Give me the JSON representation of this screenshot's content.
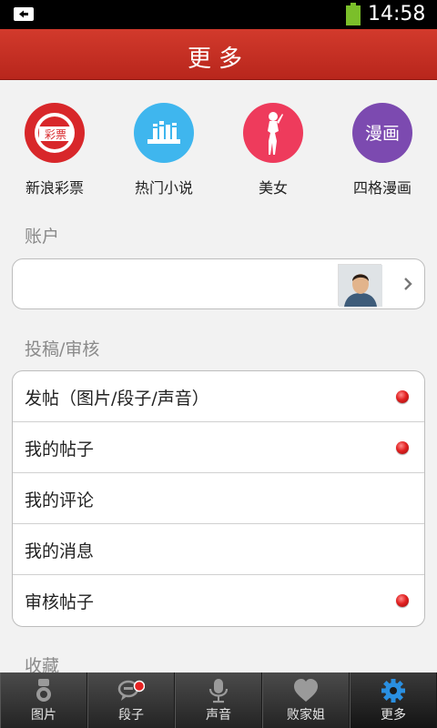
{
  "status_bar": {
    "time": "14:58"
  },
  "header": {
    "title": "更多"
  },
  "apps": [
    {
      "label": "新浪彩票",
      "icon": "sina-lottery-icon",
      "badge_text": "彩票",
      "color": "#d8272a"
    },
    {
      "label": "热门小说",
      "icon": "books-icon",
      "color": "#3fb6ee"
    },
    {
      "label": "美女",
      "icon": "woman-silhouette-icon",
      "color": "#ee3b5c"
    },
    {
      "label": "四格漫画",
      "icon": "comic-icon",
      "badge_text": "漫画",
      "color": "#7c4ab0"
    }
  ],
  "account": {
    "section_label": "账户"
  },
  "submission": {
    "section_label": "投稿/审核",
    "items": [
      {
        "label": "发帖（图片/段子/声音）",
        "has_dot": true
      },
      {
        "label": "我的帖子",
        "has_dot": true
      },
      {
        "label": "我的评论",
        "has_dot": false
      },
      {
        "label": "我的消息",
        "has_dot": false
      },
      {
        "label": "审核帖子",
        "has_dot": true
      }
    ]
  },
  "favorites": {
    "section_label": "收藏"
  },
  "tabs": [
    {
      "label": "图片",
      "icon": "camera-icon",
      "active": false
    },
    {
      "label": "段子",
      "icon": "chat-bubble-icon",
      "active": false
    },
    {
      "label": "声音",
      "icon": "microphone-icon",
      "active": false
    },
    {
      "label": "败家姐",
      "icon": "heart-icon",
      "active": false
    },
    {
      "label": "更多",
      "icon": "gear-icon",
      "active": true
    }
  ],
  "colors": {
    "header": "#c52e22",
    "accent_blue": "#2a8fe0",
    "dot_red": "#e22222"
  }
}
